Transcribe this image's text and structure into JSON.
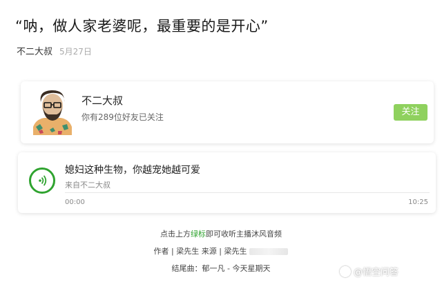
{
  "article": {
    "title": "“呐，做人家老婆呢，最重要的是开心”",
    "author": "不二大叔",
    "date": "5月27日"
  },
  "profile_card": {
    "name": "不二大叔",
    "subtitle": "你有289位好友已关注",
    "follow_label": "关注",
    "accent_color": "#8fd15e"
  },
  "audio": {
    "title": "媳妇这种生物，你越宠她越可爱",
    "source": "来自不二大叔",
    "start_time": "00:00",
    "end_time": "10:25",
    "progress_fraction": 0,
    "icon": "audio-wave-icon",
    "accent_color": "#2fa32f"
  },
  "footer": {
    "line1_pre": "点击上方",
    "line1_link": "绿标",
    "line1_post": "即可收听主播沐风音频",
    "line2": "作者 | 梁先生  来源 | 梁先生",
    "line3": "结尾曲：郁一凡 - 今天星期天"
  },
  "watermark": {
    "text": "@悟空问答",
    "icon": "wukong-logo-icon"
  }
}
